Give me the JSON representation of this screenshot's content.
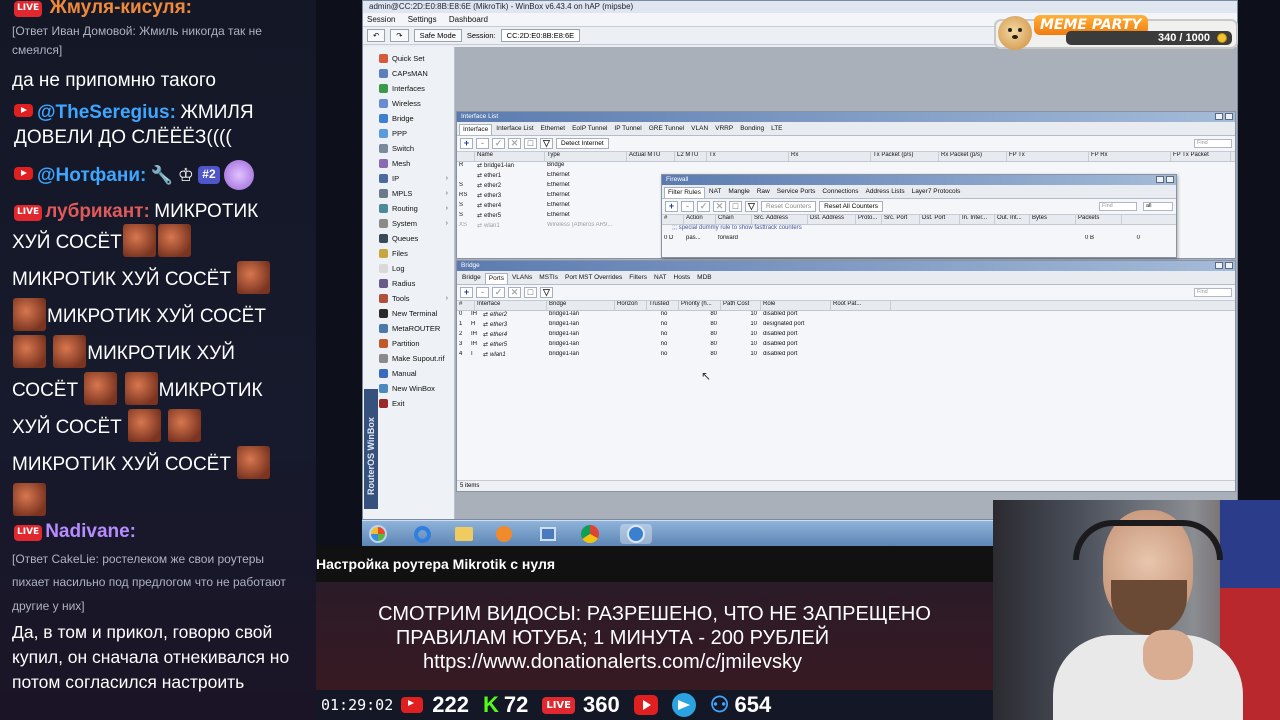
{
  "chat": {
    "messages": [
      {
        "nick": "Жмуля-кисуля:",
        "nick_color": "#f08a3a"
      },
      {
        "reply": "[Ответ Иван Домовой: Жмиль никогда так не смеялся]"
      },
      {
        "text": "да не припомню такого"
      },
      {
        "nick": "@TheSeregius:",
        "text": "ЖМИЛЯ ДОВЕЛИ ДО СЛЁЁЁЗ((((",
        "nick_color": "#3ea6ff"
      },
      {
        "nick": "@Нотфани:",
        "badge": "#2",
        "nick_color": "#3ea6ff"
      },
      {
        "nick": "лубрикант:",
        "text": "МИКРОТИК",
        "nick_color": "#e05a5a"
      },
      {
        "text1": "ХУЙ СОСЁТ",
        "text2": "МИКРОТИК ХУЙ СОСЁТ",
        "text3": "МИКРОТИК ХУЙ СОСЁТ",
        "text4": "МИКРОТИК ХУЙ",
        "text5": "СОСЁТ",
        "text6": "МИКРОТИК",
        "text7": "ХУЙ СОСЁТ",
        "text8": "МИКРОТИК ХУЙ СОСЁТ"
      },
      {
        "nick": "Nadivane:",
        "nick_color": "#b68cff"
      },
      {
        "reply": "[Ответ CakeLie: ростелеком же свои роутеры пихает насильно под предлогом что не работают другие у них]"
      },
      {
        "text": "Да, в том и прикол, говорю свой купил, он сначала отнекивался но потом согласился настроить"
      }
    ],
    "live_label": "LIVE"
  },
  "winbox": {
    "title": "admin@CC:2D:E0:8B:E8:6E (MikroTik) - WinBox v6.43.4 on hAP (mipsbe)",
    "menu": [
      "Session",
      "Settings",
      "Dashboard"
    ],
    "safe_mode": "Safe Mode",
    "session_label": "Session:",
    "session_value": "CC:2D:E0:8B:E8:6E",
    "brand": "RouterOS WinBox",
    "sidebar": [
      {
        "label": "Quick Set",
        "color": "#d45a3a"
      },
      {
        "label": "CAPsMAN",
        "color": "#5a7fbf"
      },
      {
        "label": "Interfaces",
        "color": "#3a9a4a"
      },
      {
        "label": "Wireless",
        "color": "#6a8ad0"
      },
      {
        "label": "Bridge",
        "color": "#3f7fd0"
      },
      {
        "label": "PPP",
        "color": "#5a9ae0"
      },
      {
        "label": "Switch",
        "color": "#7a8a9a"
      },
      {
        "label": "Mesh",
        "color": "#8a6ab0"
      },
      {
        "label": "IP",
        "color": "#4a6aa0",
        "arrow": true
      },
      {
        "label": "MPLS",
        "color": "#6a7a8a",
        "arrow": true
      },
      {
        "label": "Routing",
        "color": "#4a8a9a",
        "arrow": true
      },
      {
        "label": "System",
        "color": "#8a8a8a",
        "arrow": true
      },
      {
        "label": "Queues",
        "color": "#3a4a5a"
      },
      {
        "label": "Files",
        "color": "#c7a640"
      },
      {
        "label": "Log",
        "color": "#d9d9d9"
      },
      {
        "label": "Radius",
        "color": "#6a5a8a"
      },
      {
        "label": "Tools",
        "color": "#b0503a",
        "arrow": true
      },
      {
        "label": "New Terminal",
        "color": "#2a2a2a"
      },
      {
        "label": "MetaROUTER",
        "color": "#4a7aaa"
      },
      {
        "label": "Partition",
        "color": "#c05a2a"
      },
      {
        "label": "Make Supout.rif",
        "color": "#8a8a8a"
      },
      {
        "label": "Manual",
        "color": "#3a6ac0"
      },
      {
        "label": "New WinBox",
        "color": "#4a8ac0"
      },
      {
        "label": "Exit",
        "color": "#9a2a2a"
      }
    ],
    "interface_list": {
      "title": "Interface List",
      "tabs": [
        "Interface",
        "Interface List",
        "Ethernet",
        "EoIP Tunnel",
        "IP Tunnel",
        "GRE Tunnel",
        "VLAN",
        "VRRP",
        "Bonding",
        "LTE"
      ],
      "detect": "Detect Internet",
      "find": "Find",
      "columns": [
        "",
        "Name",
        "Type",
        "Actual MTU",
        "L2 MTU",
        "Tx",
        "Rx",
        "Tx Packet (p/s)",
        "Rx Packet (p/s)",
        "FP Tx",
        "FP Rx",
        "FP Tx Packet"
      ],
      "rows": [
        {
          "flag": "R",
          "name": "bridge1-lan",
          "type": "Bridge"
        },
        {
          "flag": "",
          "name": "ether1",
          "type": "Ethernet"
        },
        {
          "flag": "S",
          "name": "ether2",
          "type": "Ethernet"
        },
        {
          "flag": "RS",
          "name": "ether3",
          "type": "Ethernet"
        },
        {
          "flag": "S",
          "name": "ether4",
          "type": "Ethernet"
        },
        {
          "flag": "S",
          "name": "ether5",
          "type": "Ethernet"
        },
        {
          "flag": "XS",
          "name": "wlan1",
          "type": "Wireless (Atheros AR9..."
        }
      ]
    },
    "firewall": {
      "title": "Firewall",
      "tabs": [
        "Filter Rules",
        "NAT",
        "Mangle",
        "Raw",
        "Service Ports",
        "Connections",
        "Address Lists",
        "Layer7 Protocols"
      ],
      "reset_counters": "Reset Counters",
      "reset_all": "Reset All Counters",
      "find": "Find",
      "filter": "all",
      "columns": [
        "#",
        "Action",
        "Chain",
        "Src. Address",
        "Dst. Address",
        "Proto...",
        "Src. Port",
        "Dst. Port",
        "In. Inter...",
        "Out. Int...",
        "Bytes",
        "Packets"
      ],
      "comment": ";;; special dummy rule to show fasttrack counters",
      "row": {
        "num": "0  D",
        "action": "pas...",
        "chain": "forward",
        "bytes": "0 B",
        "packets": "0"
      }
    },
    "bridge": {
      "title": "Bridge",
      "tabs": [
        "Bridge",
        "Ports",
        "VLANs",
        "MSTIs",
        "Port MST Overrides",
        "Filters",
        "NAT",
        "Hosts",
        "MDB"
      ],
      "find": "Find",
      "columns": [
        "#",
        "Interface",
        "Bridge",
        "Horizon",
        "Trusted",
        "Priority (h...",
        "Path Cost",
        "Role",
        "Root Pat..."
      ],
      "rows": [
        {
          "num": "0",
          "flags": "IH",
          "iface": "ether2",
          "bridge": "bridge1-lan",
          "trusted": "no",
          "priority": "80",
          "cost": "10",
          "role": "disabled port"
        },
        {
          "num": "1",
          "flags": "H",
          "iface": "ether3",
          "bridge": "bridge1-lan",
          "trusted": "no",
          "priority": "80",
          "cost": "10",
          "role": "designated port"
        },
        {
          "num": "2",
          "flags": "IH",
          "iface": "ether4",
          "bridge": "bridge1-lan",
          "trusted": "no",
          "priority": "80",
          "cost": "10",
          "role": "disabled port"
        },
        {
          "num": "3",
          "flags": "IH",
          "iface": "ether5",
          "bridge": "bridge1-lan",
          "trusted": "no",
          "priority": "80",
          "cost": "10",
          "role": "disabled port"
        },
        {
          "num": "4",
          "flags": "I",
          "iface": "wlan1",
          "bridge": "bridge1-lan",
          "trusted": "no",
          "priority": "80",
          "cost": "10",
          "role": "disabled port"
        }
      ],
      "status": "5 items"
    }
  },
  "taskbar": {
    "icons": [
      "windows-start-icon",
      "internet-explorer-icon",
      "file-explorer-icon",
      "media-player-icon",
      "network-icon",
      "chrome-icon",
      "winbox-icon"
    ]
  },
  "meme": {
    "title": "MEME PARTY",
    "count": "340 / 1000"
  },
  "video_title": "Настройка роутера Mikrotik с нуля",
  "banner": {
    "line1": "СМОТРИМ ВИДОСЫ: РАЗРЕШЕНО, ЧТО НЕ ЗАПРЕЩЕНО",
    "line2": "ПРАВИЛАМ ЮТУБА; 1 МИНУТА - 200 РУБЛЕЙ",
    "line3": "https://www.donationalerts.com/c/jmilevsky"
  },
  "stats": {
    "time": "01:29:02",
    "youtube": "222",
    "kick": "72",
    "vk_live": "360",
    "total": "654"
  },
  "colors": {
    "youtube": "#e02020",
    "kick": "#53fc18",
    "vk": "#e0282e",
    "telegram": "#2aa3e0",
    "people": "#3ea6ff"
  }
}
